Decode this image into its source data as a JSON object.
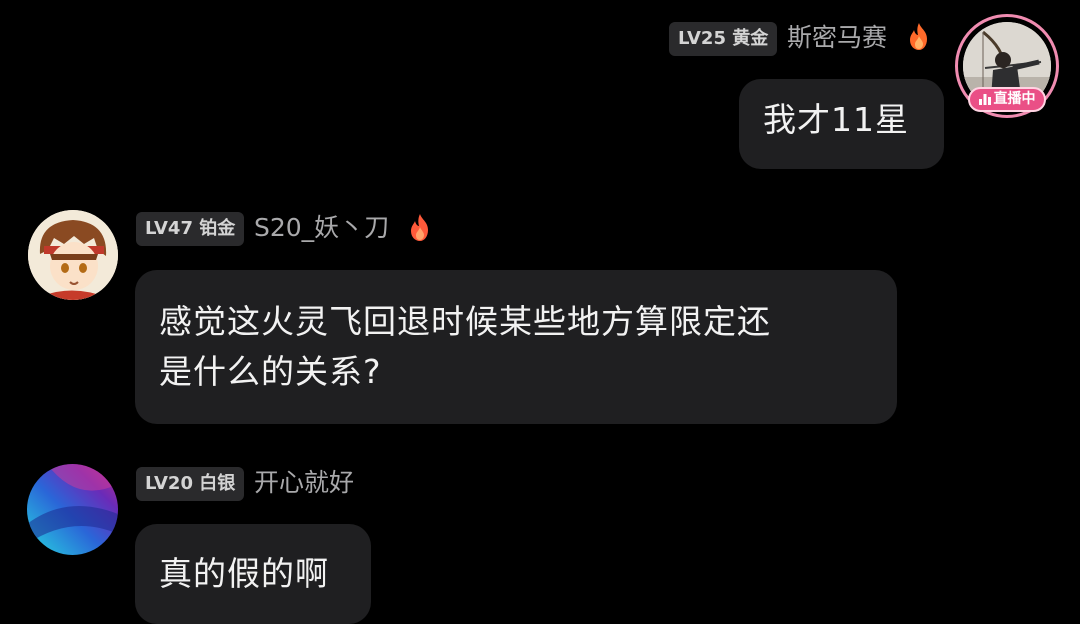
{
  "colors": {
    "background": "#000000",
    "bubble": "#1f1f21",
    "badge_bg": "#2a2a2c",
    "username": "#a9a9ab",
    "live_pink": "#ea4f86",
    "fire_orange": "#ff6a2a"
  },
  "messages": [
    {
      "side": "right",
      "level_badge": "LV25 黄金",
      "username": "斯密马赛",
      "has_fire_icon": true,
      "text": "我才11星",
      "avatar_icon": "archer-avatar",
      "live_badge": "直播中"
    },
    {
      "side": "left",
      "level_badge": "LV47 铂金",
      "username": "S20_妖丶刀",
      "has_fire_icon": true,
      "text_lines": [
        "感觉这火灵飞回退时候某些地方算限定还",
        "是什么的关系?"
      ],
      "avatar_icon": "anime-character-avatar"
    },
    {
      "side": "left",
      "level_badge": "LV20 白银",
      "username": "开心就好",
      "has_fire_icon": false,
      "text": "真的假的啊",
      "avatar_icon": "gradient-abstract-avatar"
    }
  ]
}
